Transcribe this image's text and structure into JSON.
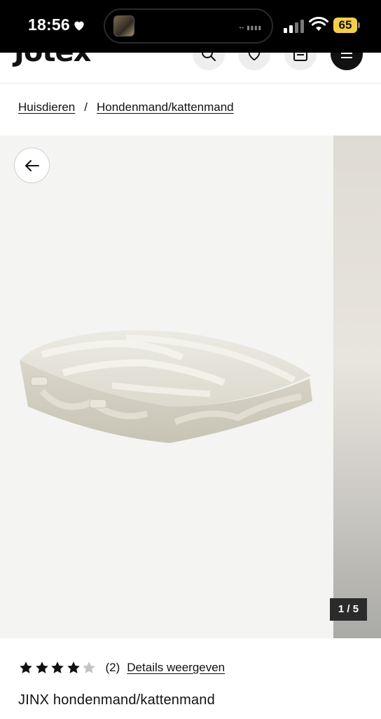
{
  "status_bar": {
    "time": "18:56",
    "battery_level": "65",
    "battery_color": "#f3d049"
  },
  "header": {
    "logo": "Jotex",
    "icons": [
      "search-icon",
      "heart-icon",
      "bag-icon",
      "menu-icon"
    ]
  },
  "breadcrumb": {
    "items": [
      "Huisdieren",
      "Hondenmand/kattenmand"
    ],
    "separator": "/"
  },
  "gallery": {
    "counter": "1 / 5",
    "current_image": 1,
    "total_images": 5,
    "back_icon": "arrow-left-icon"
  },
  "product": {
    "rating": 4,
    "max_rating": 5,
    "review_count": "(2)",
    "details_label": "Details weergeven",
    "title": "JINX hondenmand/kattenmand"
  }
}
